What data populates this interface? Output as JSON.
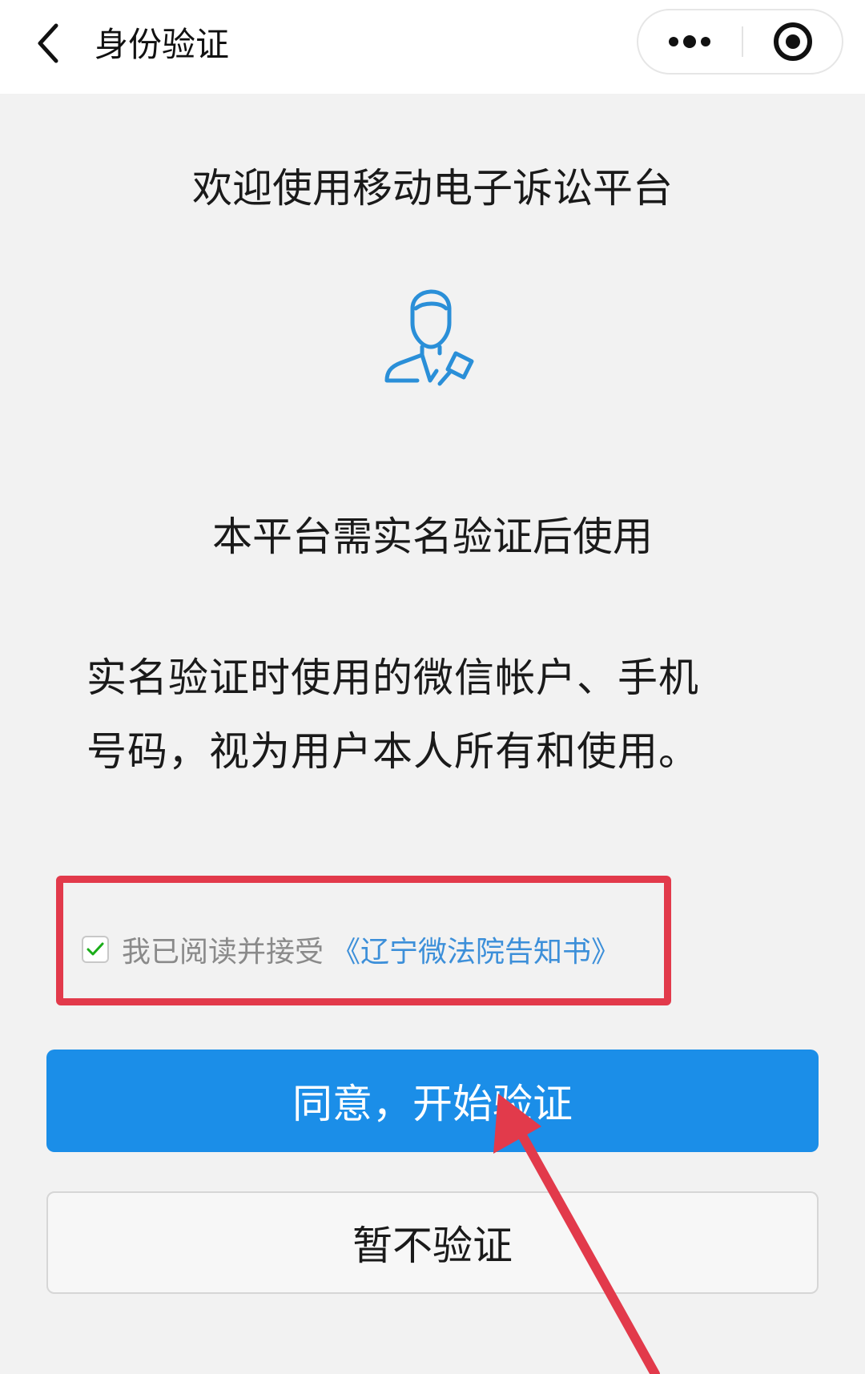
{
  "navbar": {
    "title": "身份验证",
    "back_icon": "chevron-left-icon",
    "more_icon": "more-dots-icon",
    "close_icon": "record-circle-icon"
  },
  "main": {
    "welcome": "欢迎使用移动电子诉讼平台",
    "avatar_icon": "user-gavel-icon",
    "requirement": "本平台需实名验证后使用",
    "notice_line1": "实名验证时使用的微信帐户、手机",
    "notice_line2": "号码，视为用户本人所有和使用。"
  },
  "agreement": {
    "checked": true,
    "label": "我已阅读并接受",
    "link": "《辽宁微法院告知书》"
  },
  "buttons": {
    "agree_start": "同意，开始验证",
    "skip": "暂不验证"
  },
  "colors": {
    "primary": "#1b8ee8",
    "link": "#3c8fd9",
    "annotation": "#e23a4b",
    "icon": "#2a8fd8"
  }
}
